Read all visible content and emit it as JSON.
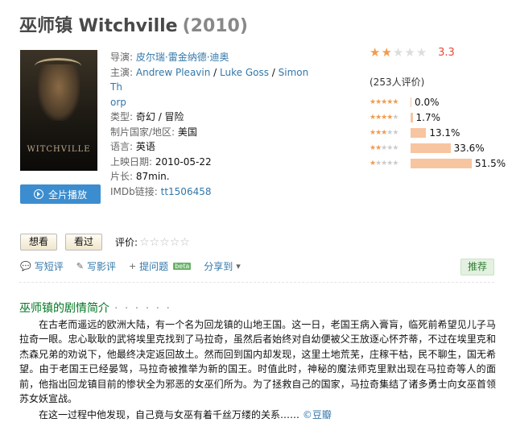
{
  "header": {
    "title": "巫师镇 Witchville",
    "year": "(2010)"
  },
  "poster": {
    "text": "WITCHVILLE"
  },
  "info": {
    "director_label": "导演:",
    "director": "皮尔瑞·雷金纳德·迪奥",
    "cast_label": "主演:",
    "cast": [
      "Andrew Pleavin",
      "Luke Goss",
      "Simon Th",
      "orp"
    ],
    "genre_label": "类型:",
    "genre": "奇幻 / 冒险",
    "country_label": "制片国家/地区:",
    "country": "美国",
    "language_label": "语言:",
    "language": "英语",
    "release_label": "上映日期:",
    "release": "2010-05-22",
    "runtime_label": "片长:",
    "runtime": "87min.",
    "imdb_label": "IMDb链接:",
    "imdb": "tt1506458"
  },
  "play_button": {
    "label": "全片播放",
    "icon": "play-circle-icon"
  },
  "rating": {
    "score": "3.3",
    "stars_filled": 2,
    "votes": "(253人评价)",
    "distribution": [
      {
        "stars": 5,
        "pct": "0.0%",
        "value": 0.0
      },
      {
        "stars": 4,
        "pct": "1.7%",
        "value": 1.7
      },
      {
        "stars": 3,
        "pct": "13.1%",
        "value": 13.1
      },
      {
        "stars": 2,
        "pct": "33.6%",
        "value": 33.6
      },
      {
        "stars": 1,
        "pct": "51.5%",
        "value": 51.5
      }
    ]
  },
  "buttons": {
    "want": "想看",
    "seen": "看过",
    "eval_label": "评价:"
  },
  "actions": {
    "short_review": "写短评",
    "review": "写影评",
    "question": "提问题",
    "beta": "beta",
    "share": "分享到",
    "recommend": "推荐"
  },
  "section": {
    "title": "巫师镇的剧情简介",
    "dots": "· · · · · ·"
  },
  "summary": {
    "p1": "在古老而遥远的欧洲大陆，有一个名为回龙镇的山地王国。这一日，老国王病入膏肓，临死前希望见儿子马拉奇一眼。忠心耿耿的武将埃里克找到了马拉奇，虽然后者始终对自幼便被父王放逐心怀芥蒂，不过在埃里克和杰森兄弟的劝说下，他最终决定返回故土。然而回到国内却发现，这里土地荒芜，庄稼干枯，民不聊生，国无希望。由于老国王已经晏驾，马拉奇被推举为新的国王。时值此时，神秘的魔法师克里默出现在马拉奇等人的面前，他指出回龙镇目前的惨状全为邪恶的女巫们所为。为了拯救自己的国家，马拉奇集结了诸多勇士向女巫首领苏女妖宣战。",
    "p2": "在这一过程中他发现，自己竟与女巫有着千丝万缕的关系……",
    "source": "©豆瓣"
  },
  "colors": {
    "link": "#3377aa",
    "star": "#f19c4e",
    "score": "#e24b3b",
    "bar": "#f7c5a0",
    "green": "#007722",
    "play": "#3c8dcf"
  }
}
